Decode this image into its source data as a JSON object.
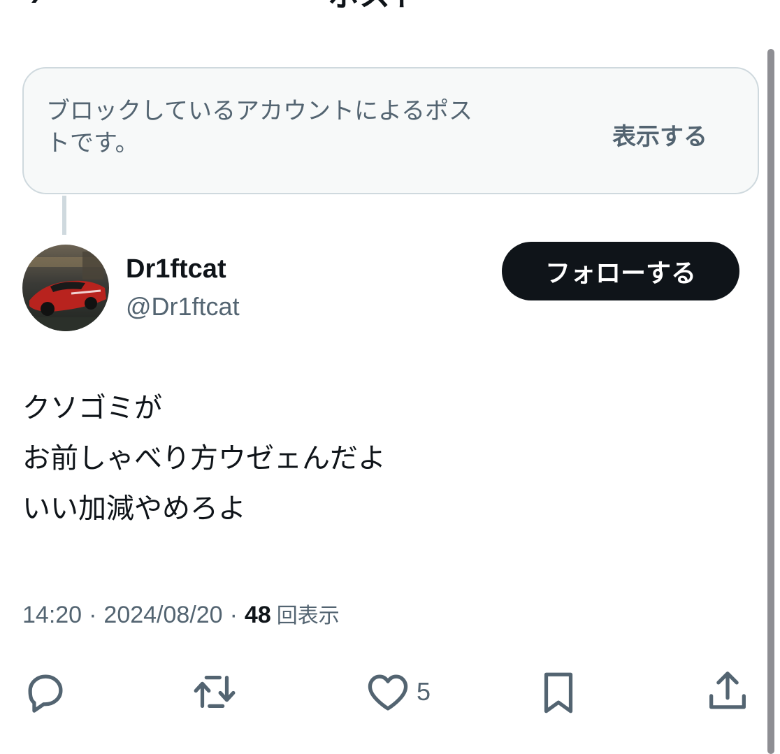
{
  "header": {
    "title": "ポスト"
  },
  "blocked_notice": {
    "message_line1": "ブロックしているアカウントによるポス",
    "message_line2": "トです。",
    "show_label": "表示する"
  },
  "post": {
    "author": {
      "display_name": "Dr1ftcat",
      "handle": "@Dr1ftcat",
      "avatar": "red-sports-car-avatar"
    },
    "follow_label": "フォローする",
    "lines": [
      "クソゴミが",
      "お前しゃべり方ウゼェんだよ",
      "いい加減やめろよ"
    ],
    "meta": {
      "time": "14:20",
      "separator": "·",
      "date": "2024/08/20",
      "views_count": "48",
      "views_label": "回表示"
    },
    "actions": {
      "reply_icon": "reply-icon",
      "repost_icon": "repost-icon",
      "like_icon": "heart-icon",
      "like_count": "5",
      "bookmark_icon": "bookmark-icon",
      "share_icon": "share-icon"
    }
  },
  "colors": {
    "text_primary": "#0f1419",
    "text_secondary": "#536471",
    "card_border": "#cfd9de",
    "card_bg": "#f7f9f9",
    "button_dark": "#0f1419"
  }
}
